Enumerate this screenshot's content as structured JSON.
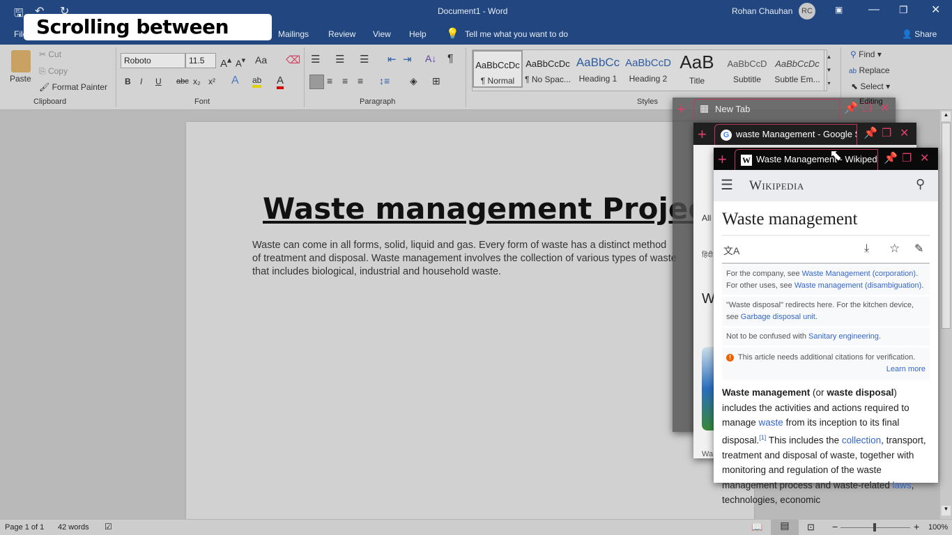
{
  "titlebar": {
    "doc_title": "Document1  -  Word",
    "user": "Rohan Chauhan",
    "initials": "RC"
  },
  "caption": "Scrolling between tabs",
  "menu": {
    "file": "File",
    "tabs": [
      "Mailings",
      "Review",
      "View",
      "Help"
    ],
    "tell_me": "Tell me what you want to do",
    "share": "Share"
  },
  "ribbon": {
    "clipboard": {
      "paste": "Paste",
      "cut": "Cut",
      "copy": "Copy",
      "format_painter": "Format Painter",
      "label": "Clipboard"
    },
    "font": {
      "name": "Roboto",
      "size": "11.5",
      "label": "Font",
      "bold": "B",
      "italic": "I",
      "underline": "U",
      "strike": "abc",
      "sub": "x₂",
      "sup": "x²",
      "case": "Aa"
    },
    "paragraph": {
      "label": "Paragraph"
    },
    "styles": {
      "label": "Styles",
      "items": [
        {
          "sample": "AaBbCcDc",
          "name": "¶ Normal"
        },
        {
          "sample": "AaBbCcDc",
          "name": "¶ No Spac..."
        },
        {
          "sample": "AaBbCc",
          "name": "Heading 1"
        },
        {
          "sample": "AaBbCcD",
          "name": "Heading 2"
        },
        {
          "sample": "AaB",
          "name": "Title"
        },
        {
          "sample": "AaBbCcD",
          "name": "Subtitle"
        },
        {
          "sample": "AaBbCcDc",
          "name": "Subtle Em..."
        }
      ]
    },
    "editing": {
      "find": "Find",
      "replace": "Replace",
      "select": "Select",
      "label": "Editing"
    }
  },
  "document": {
    "title": "Waste management Project",
    "body": "Waste can come in all forms, solid, liquid and gas. Every form of waste has a distinct method of treatment and disposal. Waste management involves the collection of various types of waste that includes biological, industrial and household waste."
  },
  "status": {
    "page": "Page 1 of 1",
    "words": "42 words",
    "zoom": "100%"
  },
  "browser": {
    "tabs": [
      "New Tab",
      "waste Management - Google S",
      "Waste Management - Wikiped"
    ],
    "accent": "#e0406a",
    "google_fragments": {
      "all": "All",
      "hindi": "हिंदी",
      "w": "W",
      "wa": "Wa"
    },
    "wiki": {
      "logo": "Wikipedia",
      "heading": "Waste management",
      "hat1_pre": "For the company, see ",
      "hat1_link1": "Waste Management (corporation)",
      "hat1_mid": ". For other uses, see ",
      "hat1_link2": "Waste management (disambiguation)",
      "hat1_end": ".",
      "hat2_pre": "\"Waste disposal\" redirects here. For the kitchen device, see ",
      "hat2_link": "Garbage disposal unit",
      "hat2_end": ".",
      "hat3_pre": "Not to be confused with ",
      "hat3_link": "Sanitary engineering",
      "hat3_end": ".",
      "notice": "This article needs additional citations for verification.",
      "learn_more": "Learn more",
      "p_b1": "Waste management",
      "p_t1": " (or ",
      "p_b2": "waste disposal",
      "p_t2": ") includes the activities and actions required to manage ",
      "p_l1": "waste",
      "p_t3": " from its inception to its final disposal.",
      "p_ref": "[1]",
      "p_t4": " This includes the ",
      "p_l2": "collection",
      "p_t5": ", transport, treatment and disposal of waste, together with monitoring and regulation of the waste management process and waste-related ",
      "p_l3": "laws",
      "p_t6": ", technologies, economic"
    }
  }
}
